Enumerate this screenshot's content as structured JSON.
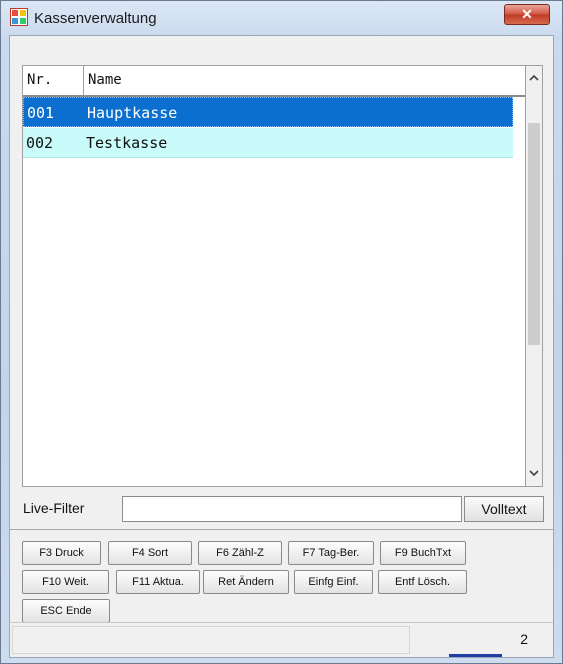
{
  "window": {
    "title": "Kassenverwaltung",
    "close_label": "✕",
    "icon": "app-grid-icon"
  },
  "grid": {
    "columns": [
      "Nr.",
      "Name"
    ],
    "rows": [
      {
        "nr": "001",
        "name": "Hauptkasse",
        "selected": true
      },
      {
        "nr": "002",
        "name": "Testkasse",
        "selected": false
      }
    ],
    "scroll_up_icon": "chevron-up-icon",
    "scroll_down_icon": "chevron-down-icon"
  },
  "filter": {
    "label": "Live-Filter",
    "value": "",
    "fulltext_button": "Volltext"
  },
  "buttons": {
    "f3": "F3 Druck",
    "f4": "F4 Sort",
    "f6": "F6 Zähl-Z",
    "f7": "F7 Tag-Ber.",
    "f9": "F9 BuchTxt",
    "f10": "F10 Weit.",
    "f11": "F11 Aktua.",
    "ret": "Ret Ändern",
    "einfg": "Einfg Einf.",
    "entf": "Entf Lösch.",
    "esc": "ESC Ende"
  },
  "status": {
    "count": "2"
  },
  "colors": {
    "selection": "#0a6fcf",
    "alt_row": "#c9fbfb",
    "close_button": "#c03a25"
  }
}
